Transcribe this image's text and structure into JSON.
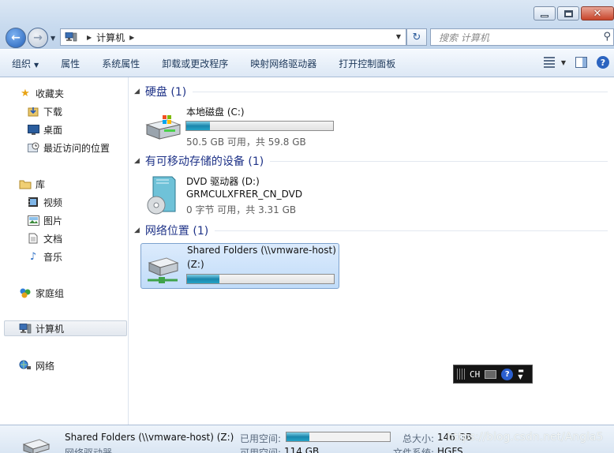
{
  "window": {
    "min_label": "",
    "max_label": "",
    "close_label": "✕"
  },
  "nav": {
    "breadcrumb": [
      "计算机"
    ],
    "search_placeholder": "搜索 计算机"
  },
  "toolbar": {
    "organize": "组织",
    "properties": "属性",
    "system_properties": "系统属性",
    "uninstall": "卸载或更改程序",
    "map_drive": "映射网络驱动器",
    "control_panel": "打开控制面板"
  },
  "sidebar": {
    "favorites": "收藏夹",
    "downloads": "下载",
    "desktop": "桌面",
    "recent": "最近访问的位置",
    "libraries": "库",
    "videos": "视频",
    "pictures": "图片",
    "documents": "文档",
    "music": "音乐",
    "homegroup": "家庭组",
    "computer": "计算机",
    "network": "网络"
  },
  "groups": {
    "hard_disks": "硬盘 (1)",
    "removable": "有可移动存储的设备 (1)",
    "network_locations": "网络位置 (1)"
  },
  "drives": {
    "local": {
      "name": "本地磁盘 (C:)",
      "free_text": "50.5 GB 可用，共 59.8 GB",
      "used_fraction": 0.16
    },
    "dvd": {
      "name": "DVD 驱动器 (D:)",
      "label": "GRMCULXFRER_CN_DVD",
      "free_text": "0 字节 可用，共 3.31 GB"
    },
    "shared": {
      "name": "Shared Folders (\\\\vmware-host)",
      "name2": "(Z:)",
      "used_fraction": 0.22
    }
  },
  "status": {
    "name": "Shared Folders (\\\\vmware-host) (Z:)",
    "type": "网络驱动器",
    "used_label": "已用空间:",
    "free_label": "可用空间:",
    "free_value": "114 GB",
    "total_label": "总大小:",
    "total_value": "146 GB",
    "fs_label": "文件系统:",
    "fs_value": "HGFS",
    "used_fraction": 0.22
  },
  "watermark": "https://blog.csdn.net/Angla5",
  "language_bar": {
    "lang": "CH",
    "help": "?"
  },
  "colors": {
    "accent": "#1e3287",
    "bar_fill": "#1a86ac"
  }
}
